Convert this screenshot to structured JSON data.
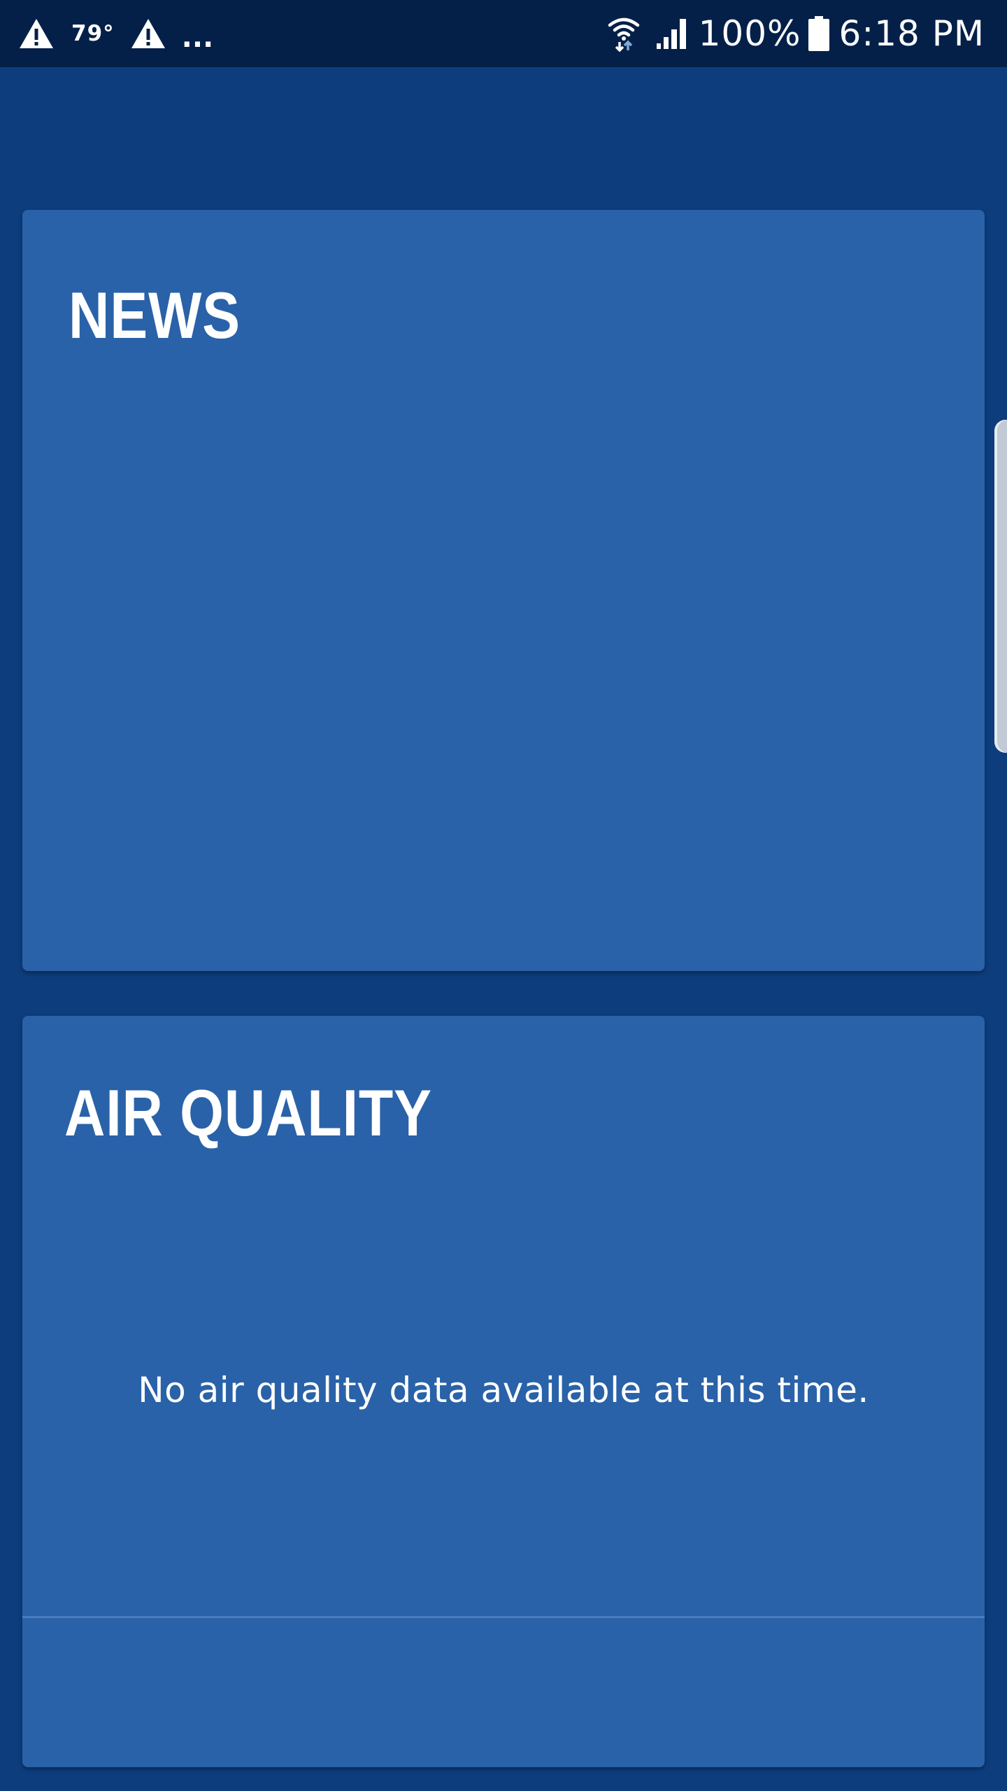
{
  "status_bar": {
    "temperature": "79°",
    "overflow_indicator": "...",
    "battery_percent": "100%",
    "time": "6:18 PM",
    "icons": [
      "alert-icon",
      "alert-icon",
      "wifi-icon",
      "signal-icon",
      "battery-icon"
    ]
  },
  "news_card": {
    "title": "NEWS"
  },
  "air_quality_card": {
    "title": "AIR QUALITY",
    "message": "No air quality data available at this time."
  },
  "colors": {
    "background": "#0d3d7c",
    "status_bar": "#052048",
    "card": "#2962a8",
    "text": "#ffffff"
  }
}
